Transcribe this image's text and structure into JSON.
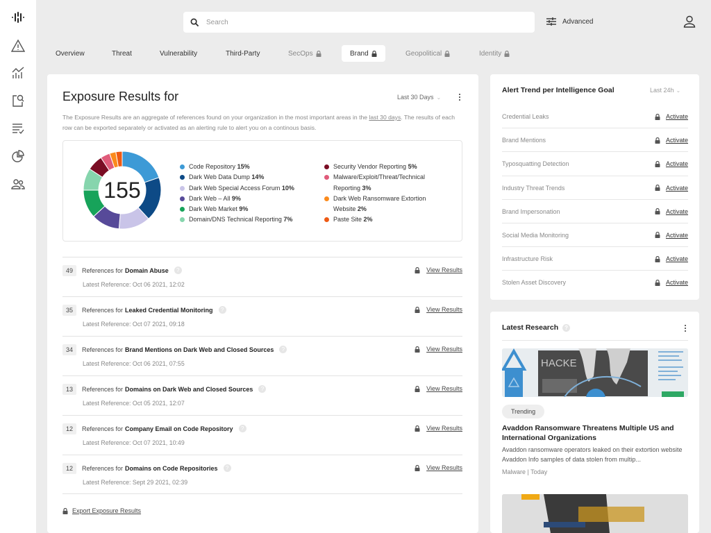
{
  "sidebar": {
    "items": [
      {
        "name": "logo",
        "icon": "logo-icon"
      },
      {
        "name": "alerts",
        "icon": "warning-triangle-icon"
      },
      {
        "name": "analytics",
        "icon": "chart-icon"
      },
      {
        "name": "investigate",
        "icon": "search-document-icon"
      },
      {
        "name": "tasks",
        "icon": "checklist-icon"
      },
      {
        "name": "reports",
        "icon": "pie-chart-icon"
      },
      {
        "name": "users",
        "icon": "users-icon"
      }
    ]
  },
  "search": {
    "placeholder": "Search",
    "advanced_label": "Advanced"
  },
  "tabs": [
    {
      "label": "Overview",
      "locked": false,
      "active": false
    },
    {
      "label": "Threat",
      "locked": false,
      "active": false
    },
    {
      "label": "Vulnerability",
      "locked": false,
      "active": false
    },
    {
      "label": "Third-Party",
      "locked": false,
      "active": false
    },
    {
      "label": "SecOps",
      "locked": true,
      "active": false
    },
    {
      "label": "Brand",
      "locked": true,
      "active": true
    },
    {
      "label": "Geopolitical",
      "locked": true,
      "active": false
    },
    {
      "label": "Identity",
      "locked": true,
      "active": false
    }
  ],
  "exposure": {
    "title": "Exposure Results for",
    "range": "Last 30 Days",
    "description_before": "The Exposure Results are an aggregate of references found on your organization in the most important areas in the ",
    "description_link": "last 30 days",
    "description_after": ". The results of each row can be exported separately or activated as an alerting rule to alert you on a continous basis.",
    "total": "155",
    "rows": [
      {
        "count": "49",
        "prefix": "References for",
        "topic": "Domain Abuse",
        "latest": "Latest Reference: Oct 06 2021, 12:02",
        "action": "View Results"
      },
      {
        "count": "35",
        "prefix": "References for",
        "topic": "Leaked Credential Monitoring",
        "latest": "Latest Reference: Oct 07 2021, 09:18",
        "action": "View Results"
      },
      {
        "count": "34",
        "prefix": "References for",
        "topic": "Brand Mentions on Dark Web and Closed Sources",
        "latest": "Latest Reference: Oct 06 2021, 07:55",
        "action": "View Results"
      },
      {
        "count": "13",
        "prefix": "References for",
        "topic": "Domains on Dark Web and Closed Sources",
        "latest": "Latest Reference: Oct 05 2021, 12:07",
        "action": "View Results"
      },
      {
        "count": "12",
        "prefix": "References for",
        "topic": "Company Email on Code Repository",
        "latest": "Latest Reference: Oct 07 2021, 10:49",
        "action": "View Results"
      },
      {
        "count": "12",
        "prefix": "References for",
        "topic": "Domains on Code Repositories",
        "latest": "Latest Reference: Sept 29 2021, 02:39",
        "action": "View Results"
      }
    ],
    "export_label": "Export Exposure Results"
  },
  "chart_data": {
    "type": "pie",
    "subtype": "donut",
    "center_label": "155",
    "categories": [
      "Code Repository",
      "Dark Web Data Dump",
      "Dark Web Special Access Forum",
      "Dark Web – All",
      "Dark Web Market",
      "Domain/DNS Technical Reporting",
      "Security Vendor Reporting",
      "Malware/Exploit/Threat/Technical Reporting",
      "Dark Web Ransomware Extortion Website",
      "Paste Site"
    ],
    "values": [
      15,
      14,
      10,
      9,
      9,
      7,
      5,
      3,
      2,
      2
    ],
    "value_labels": [
      "15%",
      "14%",
      "10%",
      "9%",
      "9%",
      "7%",
      "5%",
      "3%",
      "2%",
      "2%"
    ],
    "colors": [
      "#3d9ad6",
      "#0d4a86",
      "#c9c4e8",
      "#574a99",
      "#17a35a",
      "#86d5ad",
      "#7a0d24",
      "#e05b7a",
      "#fb8a1c",
      "#ee5a14"
    ],
    "legend_position": "right"
  },
  "alerts": {
    "title": "Alert Trend per Intelligence Goal",
    "range": "Last 24h",
    "items": [
      {
        "name": "Credential Leaks",
        "action": "Activate"
      },
      {
        "name": "Brand Mentions",
        "action": "Activate"
      },
      {
        "name": "Typosquatting Detection",
        "action": "Activate"
      },
      {
        "name": "Industry Threat Trends",
        "action": "Activate"
      },
      {
        "name": "Brand Impersonation",
        "action": "Activate"
      },
      {
        "name": "Social Media Monitoring",
        "action": "Activate"
      },
      {
        "name": "Infrastructure Risk",
        "action": "Activate"
      },
      {
        "name": "Stolen Asset Discovery",
        "action": "Activate"
      }
    ]
  },
  "research": {
    "title": "Latest Research",
    "image_text": "HACKE",
    "tag": "Trending",
    "article_title": "Avaddon Ransomware Threatens Multiple US and International Organizations",
    "article_desc": "Avaddon ransomware operators leaked on their extortion website Avaddon Info samples of data stolen from multip...",
    "meta": "Malware | Today"
  }
}
